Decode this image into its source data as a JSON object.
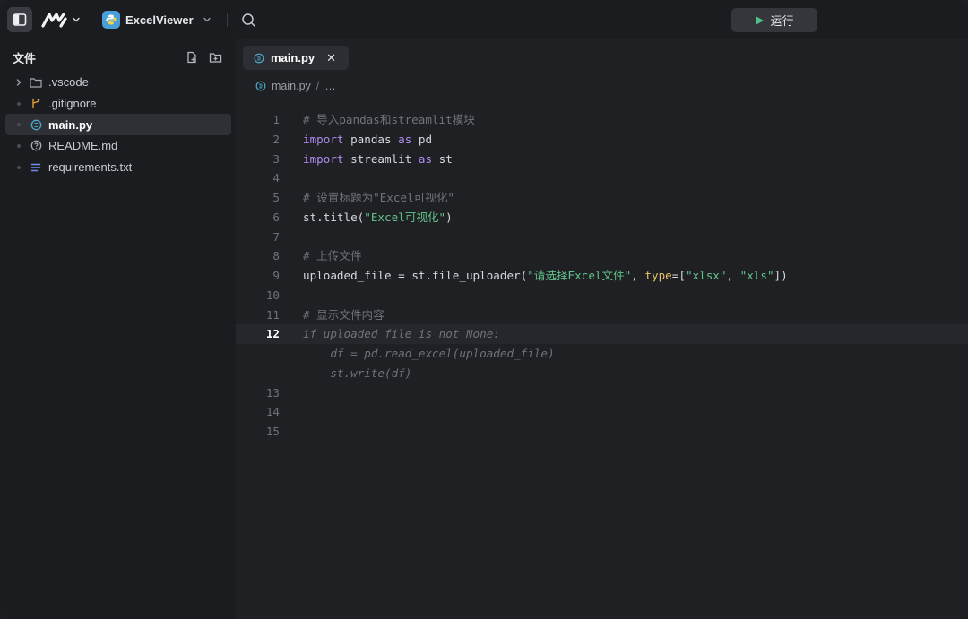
{
  "project": {
    "name": "ExcelViewer"
  },
  "toolbar": {
    "run_label": "运行"
  },
  "sidebar": {
    "title": "文件",
    "items": [
      {
        "label": ".vscode",
        "kind": "folder",
        "icon": "folder-icon"
      },
      {
        "label": ".gitignore",
        "kind": "file",
        "icon": "git-icon"
      },
      {
        "label": "main.py",
        "kind": "file",
        "icon": "python-file-icon",
        "active": true
      },
      {
        "label": "README.md",
        "kind": "file",
        "icon": "readme-icon"
      },
      {
        "label": "requirements.txt",
        "kind": "file",
        "icon": "text-file-icon"
      }
    ]
  },
  "editor": {
    "tab_label": "main.py",
    "breadcrumb": {
      "file": "main.py",
      "sep": "/",
      "more": "…"
    },
    "current_line": "12",
    "lines": [
      {
        "n": "1",
        "parts": [
          {
            "t": "# 导入pandas和streamlit模块",
            "c": "cm"
          }
        ]
      },
      {
        "n": "2",
        "parts": [
          {
            "t": "import",
            "c": "kw"
          },
          {
            "t": " pandas ",
            "c": "id"
          },
          {
            "t": "as",
            "c": "kw"
          },
          {
            "t": " pd",
            "c": "id"
          }
        ]
      },
      {
        "n": "3",
        "parts": [
          {
            "t": "import",
            "c": "kw"
          },
          {
            "t": " streamlit ",
            "c": "id"
          },
          {
            "t": "as",
            "c": "kw"
          },
          {
            "t": " st",
            "c": "id"
          }
        ]
      },
      {
        "n": "4",
        "parts": []
      },
      {
        "n": "5",
        "parts": [
          {
            "t": "# 设置标题为\"Excel可视化\"",
            "c": "cm"
          }
        ]
      },
      {
        "n": "6",
        "parts": [
          {
            "t": "st.title(",
            "c": "id"
          },
          {
            "t": "\"Excel可视化\"",
            "c": "str"
          },
          {
            "t": ")",
            "c": "id"
          }
        ]
      },
      {
        "n": "7",
        "parts": []
      },
      {
        "n": "8",
        "parts": [
          {
            "t": "# 上传文件",
            "c": "cm"
          }
        ]
      },
      {
        "n": "9",
        "parts": [
          {
            "t": "uploaded_file = st.file_uploader(",
            "c": "id"
          },
          {
            "t": "\"请选择Excel文件\"",
            "c": "str"
          },
          {
            "t": ", ",
            "c": "id"
          },
          {
            "t": "type",
            "c": "param"
          },
          {
            "t": "=[",
            "c": "id"
          },
          {
            "t": "\"xlsx\"",
            "c": "str"
          },
          {
            "t": ", ",
            "c": "id"
          },
          {
            "t": "\"xls\"",
            "c": "str"
          },
          {
            "t": "])",
            "c": "id"
          }
        ]
      },
      {
        "n": "10",
        "parts": []
      },
      {
        "n": "11",
        "parts": [
          {
            "t": "# 显示文件内容",
            "c": "cm"
          }
        ]
      },
      {
        "n": "12",
        "parts": [
          {
            "t": "if uploaded_file is not None:",
            "c": "ghost"
          }
        ]
      },
      {
        "n": "",
        "parts": [
          {
            "t": "    df = pd.read_excel(uploaded_file)",
            "c": "ghost"
          }
        ]
      },
      {
        "n": "",
        "parts": [
          {
            "t": "    st.write(df)",
            "c": "ghost"
          }
        ]
      },
      {
        "n": "13",
        "parts": []
      },
      {
        "n": "14",
        "parts": []
      },
      {
        "n": "15",
        "parts": []
      }
    ]
  },
  "colors": {
    "accent": "#3b82f6",
    "run_icon": "#4cc38a",
    "python_icon": "#4a9fd8",
    "git_icon": "#e0a030"
  }
}
